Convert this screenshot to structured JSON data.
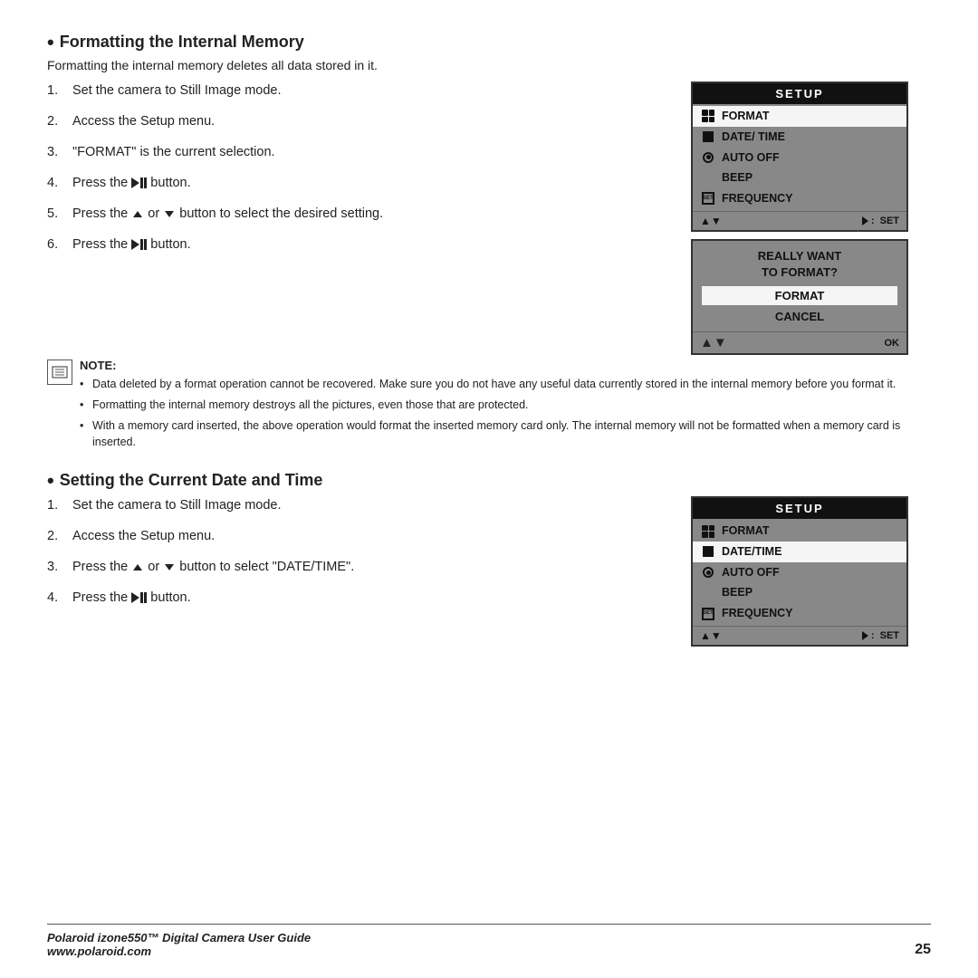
{
  "page": {
    "section1": {
      "heading": "Formatting the Internal Memory",
      "intro": "Formatting the internal memory deletes all data stored in it.",
      "steps": [
        {
          "num": "1.",
          "text": "Set the camera to Still Image mode."
        },
        {
          "num": "2.",
          "text": "Access the Setup menu."
        },
        {
          "num": "3.",
          "text": "\"FORMAT\" is the current selection."
        },
        {
          "num": "4.",
          "text": "Press the ▶II button."
        },
        {
          "num": "5.",
          "text": "Press the ▲ or ▼ button to select the desired setting."
        },
        {
          "num": "6.",
          "text": "Press the ▶II button."
        }
      ],
      "note_label": "NOTE:",
      "note_bullets": [
        "Data deleted by a format operation cannot be recovered. Make sure you do not have any useful data currently stored in the internal memory before you format it.",
        "Formatting the internal memory destroys all the pictures, even those that are protected.",
        "With a memory card inserted, the above operation would format the inserted memory card only. The internal memory will not be formatted when a memory card is inserted."
      ]
    },
    "section2": {
      "heading": "Setting the Current Date and Time",
      "steps": [
        {
          "num": "1.",
          "text": "Set the camera to Still Image mode."
        },
        {
          "num": "2.",
          "text": "Access the Setup menu."
        },
        {
          "num": "3.",
          "text": "Press the ▲ or ▼ button to select \"DATE/TIME\"."
        },
        {
          "num": "4.",
          "text": "Press the ▶II button."
        }
      ]
    },
    "lcd_panel1": {
      "header": "SETUP",
      "rows": [
        {
          "label": "FORMAT",
          "selected": true,
          "icon": "grid"
        },
        {
          "label": "DATE/ TIME",
          "selected": false,
          "icon": "square"
        },
        {
          "label": "AUTO OFF",
          "selected": false,
          "icon": "circle"
        },
        {
          "label": "BEEP",
          "selected": false,
          "icon": null
        },
        {
          "label": "FREQUENCY",
          "selected": false,
          "icon": "setup"
        }
      ],
      "footer_av": "▲▼",
      "footer_set": "▶ :  SET"
    },
    "confirm_panel": {
      "question_line1": "REALLY WANT",
      "question_line2": "TO FORMAT?",
      "option_format": "FORMAT",
      "option_cancel": "CANCEL",
      "footer_av": "▲▼",
      "footer_ok": "OK"
    },
    "lcd_panel2": {
      "header": "SETUP",
      "rows": [
        {
          "label": "FORMAT",
          "selected": false,
          "icon": "grid"
        },
        {
          "label": "DATE/TIME",
          "selected": true,
          "icon": "square"
        },
        {
          "label": "AUTO OFF",
          "selected": false,
          "icon": "circle"
        },
        {
          "label": "BEEP",
          "selected": false,
          "icon": null
        },
        {
          "label": "FREQUENCY",
          "selected": false,
          "icon": "setup"
        }
      ],
      "footer_av": "▲▼",
      "footer_set": "▶ :  SET"
    },
    "footer": {
      "brand": "Polaroid izone550™ Digital Camera User Guide",
      "url": "www.polaroid.com",
      "page_num": "25"
    }
  }
}
